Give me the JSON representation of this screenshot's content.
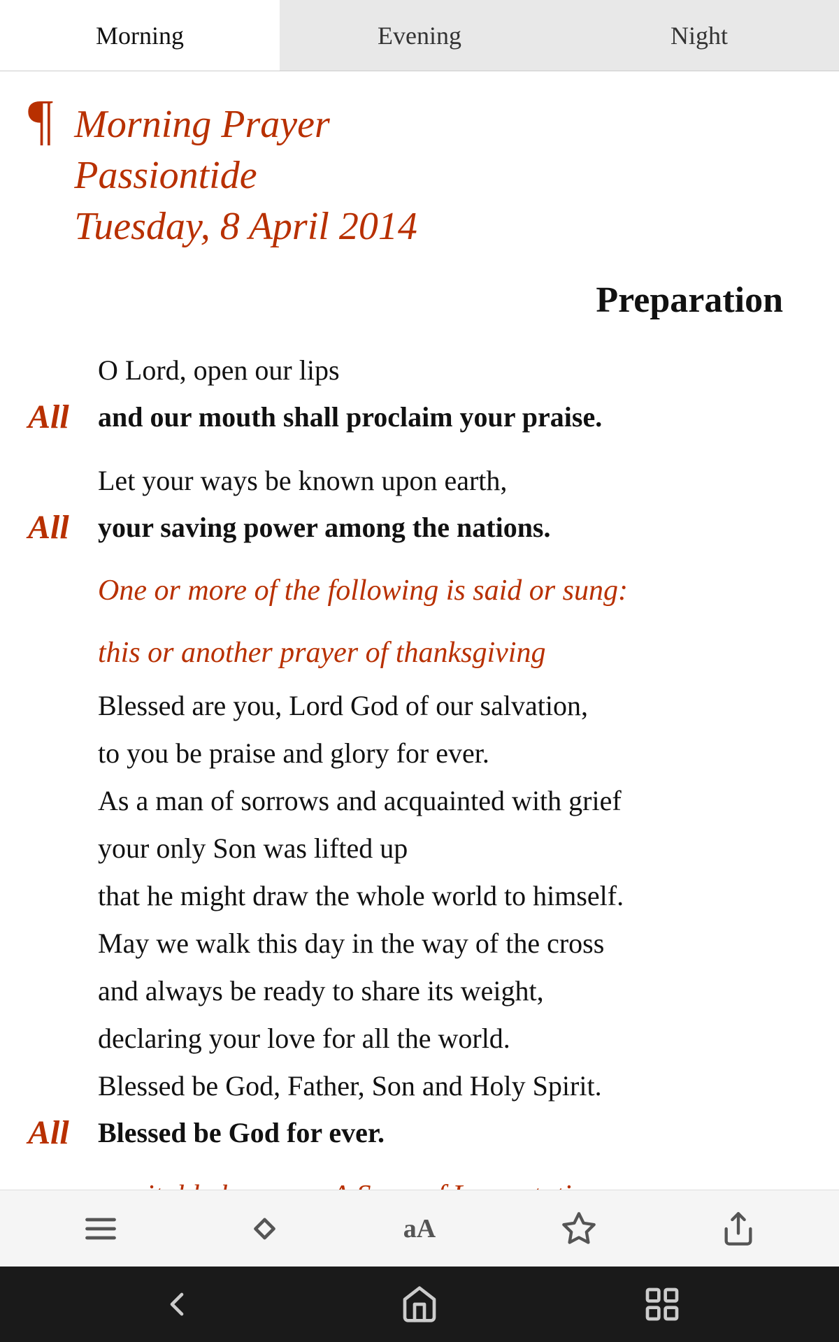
{
  "tabs": [
    {
      "id": "morning",
      "label": "Morning",
      "active": true
    },
    {
      "id": "evening",
      "label": "Evening",
      "active": false
    },
    {
      "id": "night",
      "label": "Night",
      "active": false
    }
  ],
  "header": {
    "paragraph_mark": "¶",
    "title_lines": [
      "Morning Prayer",
      "Passiontide",
      "Tuesday, 8 April 2014"
    ]
  },
  "preparation_heading": "Preparation",
  "content": {
    "verse1_plain": "O Lord, open our lips",
    "verse1_all_label": "All",
    "verse1_bold": "and our mouth shall proclaim your praise.",
    "verse2_plain": "Let your ways be known upon earth,",
    "verse2_all_label": "All",
    "verse2_bold": "your saving power among the nations.",
    "instruction1": "One or more of the following is said or sung:",
    "instruction2": "this or another prayer of thanksgiving",
    "blessing_lines": [
      "Blessed are you, Lord God of our salvation,",
      "to you be praise and glory for ever.",
      "As a man of sorrows and acquainted with grief",
      "your only Son was lifted up",
      "that he might draw the whole world to himself.",
      "May we walk this day in the way of the cross",
      "and always be ready to share its weight,",
      "declaring your love for all the world.",
      "Blessed be God, Father, Son and Holy Spirit."
    ],
    "blessing_all_label": "All",
    "blessing_bold": "Blessed be God for ever.",
    "instruction3": "a suitable hymn, or A Song of Lamentation"
  },
  "toolbar": {
    "list_icon": "list",
    "arrow_icon": "arrows",
    "font_icon": "aA",
    "star_icon": "star",
    "share_icon": "share"
  },
  "navbar": {
    "back_icon": "back",
    "home_icon": "home",
    "recents_icon": "recents"
  },
  "colors": {
    "accent": "#b83000",
    "tab_active_bg": "#ffffff",
    "tab_inactive_bg": "#e8e8e8"
  }
}
